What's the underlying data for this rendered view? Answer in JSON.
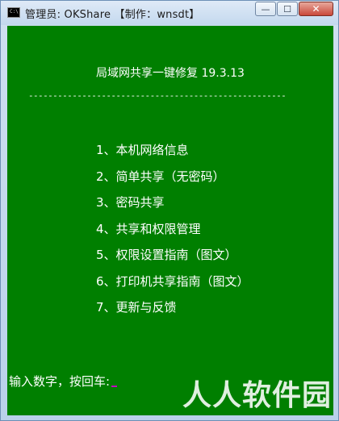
{
  "window": {
    "title": "管理员:  OKShare 【制作：wnsdt】",
    "icon": "cmd-icon",
    "icon_text": "C:\\",
    "buttons": {
      "minimize": "—",
      "maximize": "☐",
      "close": "✕"
    }
  },
  "console": {
    "title": "局域网共享一键修复 19.3.13",
    "divider": "-----------------------------------------------------",
    "menu": [
      "1、本机网络信息",
      "2、简单共享（无密码）",
      "3、密码共享",
      "4、共享和权限管理",
      "5、权限设置指南（图文）",
      "6、打印机共享指南（图文）",
      "7、更新与反馈"
    ],
    "prompt": "输入数字，按回车:",
    "background": "#007f00",
    "text_color": "#ffffff",
    "cursor_color": "#c000c0"
  },
  "watermark": {
    "text": "人人软件园"
  }
}
